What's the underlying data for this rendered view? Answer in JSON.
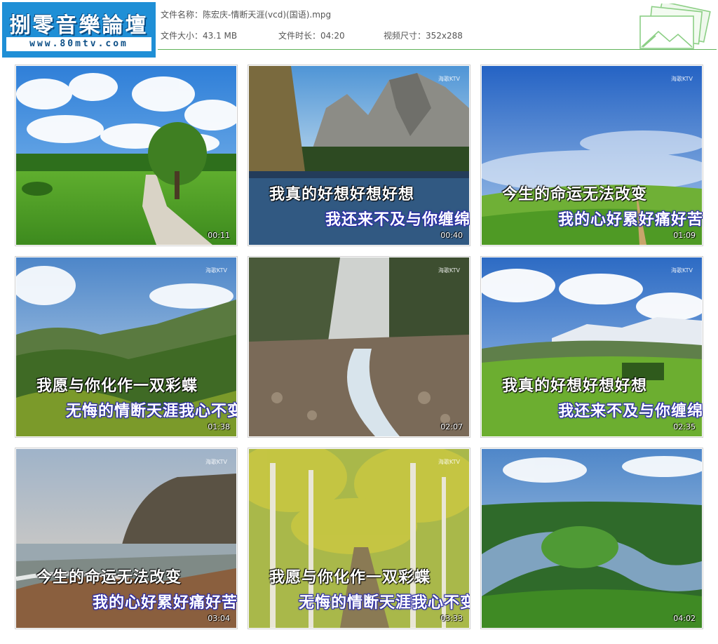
{
  "header": {
    "logo_title": "捌零音樂論壇",
    "logo_url": "www.80mtv.com",
    "file_name_label": "文件名称：",
    "file_name": "陈宏庆-情断天涯(vcd)(国语).mpg",
    "size_label": "文件大小：",
    "size": "43.1 MB",
    "duration_label": "文件时长：",
    "duration": "04:20",
    "resolution_label": "视频尺寸：",
    "resolution": "352x288",
    "accent_color": "#5fb35a",
    "logo_color": "#1f8fd6"
  },
  "thumbnails": [
    {
      "time": "00:11",
      "watermark": "",
      "line1": "",
      "line2": "",
      "scene": "meadow-tree-road"
    },
    {
      "time": "00:40",
      "watermark": "海歌KTV",
      "line1": "我真的好想好想好想",
      "line2": "我还来不及与你缠绵",
      "scene": "mountain-lake"
    },
    {
      "time": "01:09",
      "watermark": "海歌KTV",
      "line1": "今生的命运无法改变",
      "line2": "我的心好累好痛好苦",
      "scene": "green-hills-blue-sky"
    },
    {
      "time": "01:38",
      "watermark": "海歌KTV",
      "line1": "我愿与你化作一双彩蝶",
      "line2": "无悔的情断天涯我心不变",
      "scene": "mountain-valley"
    },
    {
      "time": "02:07",
      "watermark": "海歌KTV",
      "line1": "",
      "line2": "",
      "scene": "foggy-forest-stream"
    },
    {
      "time": "02:35",
      "watermark": "海歌KTV",
      "line1": "我真的好想好想好想",
      "line2": "我还来不及与你缠绵",
      "scene": "snowy-mountains-meadow"
    },
    {
      "time": "03:04",
      "watermark": "海歌KTV",
      "line1": "今生的命运无法改变",
      "line2": "我的心好累好痛好苦",
      "scene": "coastal-cliff"
    },
    {
      "time": "03:33",
      "watermark": "海歌KTV",
      "line1": "我愿与你化作一双彩蝶",
      "line2": "无悔的情断天涯我心不变",
      "scene": "autumn-forest-path"
    },
    {
      "time": "04:02",
      "watermark": "",
      "line1": "",
      "line2": "",
      "scene": "river-bend"
    }
  ]
}
